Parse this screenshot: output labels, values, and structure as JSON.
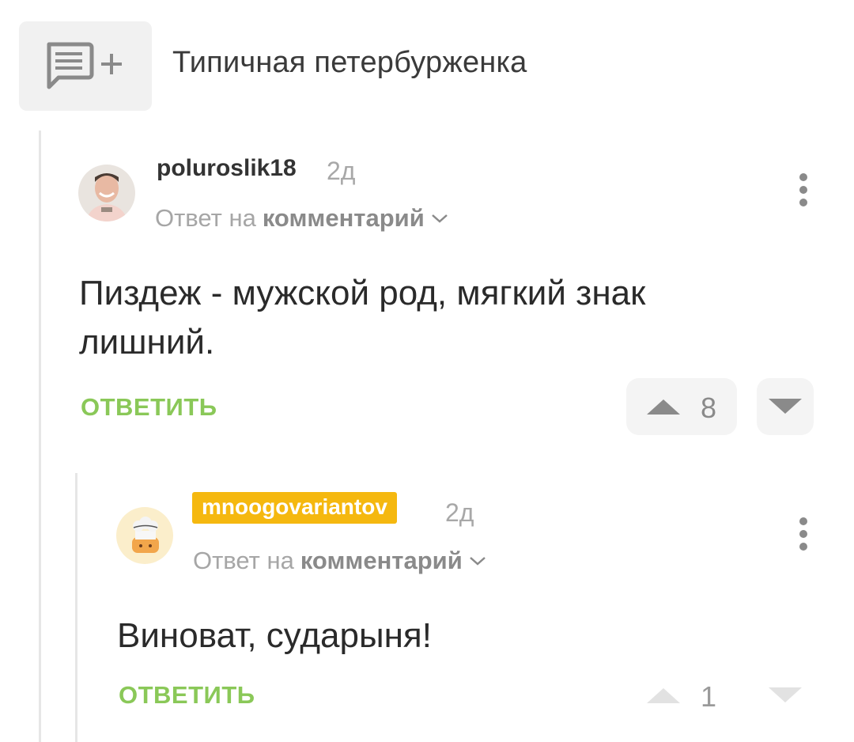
{
  "header": {
    "title": "Типичная петербурженка"
  },
  "comments": [
    {
      "username": "poluroslik18",
      "time": "2д",
      "reply_to_prefix": "Ответ на",
      "reply_to_target": "комментарий",
      "text": "Пиздеж - мужской род, мягкий знак лишний.",
      "reply_label": "ОТВЕТИТЬ",
      "rating": "8"
    },
    {
      "username": "mnoogovariantov",
      "time": "2д",
      "reply_to_prefix": "Ответ на",
      "reply_to_target": "комментарий",
      "text": "Виноват, сударыня!",
      "reply_label": "ОТВЕТИТЬ",
      "rating": "1"
    }
  ],
  "colors": {
    "accent_green": "#8ac858",
    "username_badge": "#f5b80f",
    "muted_text": "#a6a6a6"
  },
  "icons": {
    "subscribe": "comment-plus-icon",
    "more": "kebab-menu-icon",
    "upvote": "triangle-up-icon",
    "downvote": "triangle-down-icon",
    "reply_to_expand": "chevron-down-icon"
  }
}
